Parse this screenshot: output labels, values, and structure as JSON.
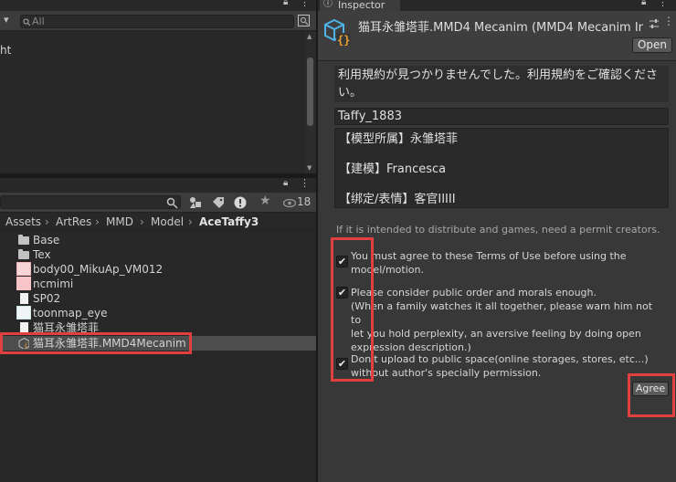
{
  "hierarchy": {
    "search_placeholder": "All",
    "partial_item": "ht"
  },
  "project": {
    "hidden_count": "18",
    "breadcrumb": [
      "Assets",
      "ArtRes",
      "MMD",
      "Model",
      "AceTaffy3"
    ],
    "items": [
      {
        "label": "Base",
        "icon": "folder-icon"
      },
      {
        "label": "Tex",
        "icon": "folder-icon"
      },
      {
        "label": "body00_MikuAp_VM012",
        "icon": "texture-icon"
      },
      {
        "label": "ncmimi",
        "icon": "texture-icon"
      },
      {
        "label": "SP02",
        "icon": "document-icon"
      },
      {
        "label": "toonmap_eye",
        "icon": "texture-icon"
      },
      {
        "label": "猫耳永雏塔菲",
        "icon": "document-icon"
      },
      {
        "label": "猫耳永雏塔菲.MMD4Mecanim",
        "icon": "mmd4mecanim-icon"
      }
    ]
  },
  "inspector": {
    "tab_label": "Inspector",
    "asset_title": "猫耳永雏塔菲.MMD4 Mecanim (MMD4 Mecanim Im",
    "open_label": "Open",
    "notice": "利用規約が見つかりませんでした。利用規約をご確認ください。",
    "model_name": "Taffy_1883",
    "info_lines": [
      "【模型所属】永雏塔菲",
      "【建模】Francesca",
      "【绑定/表情】客官IIIII"
    ],
    "hint": "If it is intended to distribute and games, need a permit creators.",
    "terms": [
      {
        "text": "You must agree to these Terms of Use before using the\nmodel/motion.",
        "checked": true
      },
      {
        "text": "Please consider public order and morals enough.\n(When a family watches it all together, please warn him not to\nlet you hold perplexity, an aversive feeling by doing open\nexpression description.)",
        "checked": true
      },
      {
        "text": "Don't upload to public space(online storages, stores, etc...)\nwithout author's specially permission.",
        "checked": true
      }
    ],
    "agree_label": "Agree"
  },
  "colors": {
    "highlight": "#e0403f",
    "asset_icon": "#4fb3e8",
    "asset_icon_accent": "#f0a030"
  }
}
